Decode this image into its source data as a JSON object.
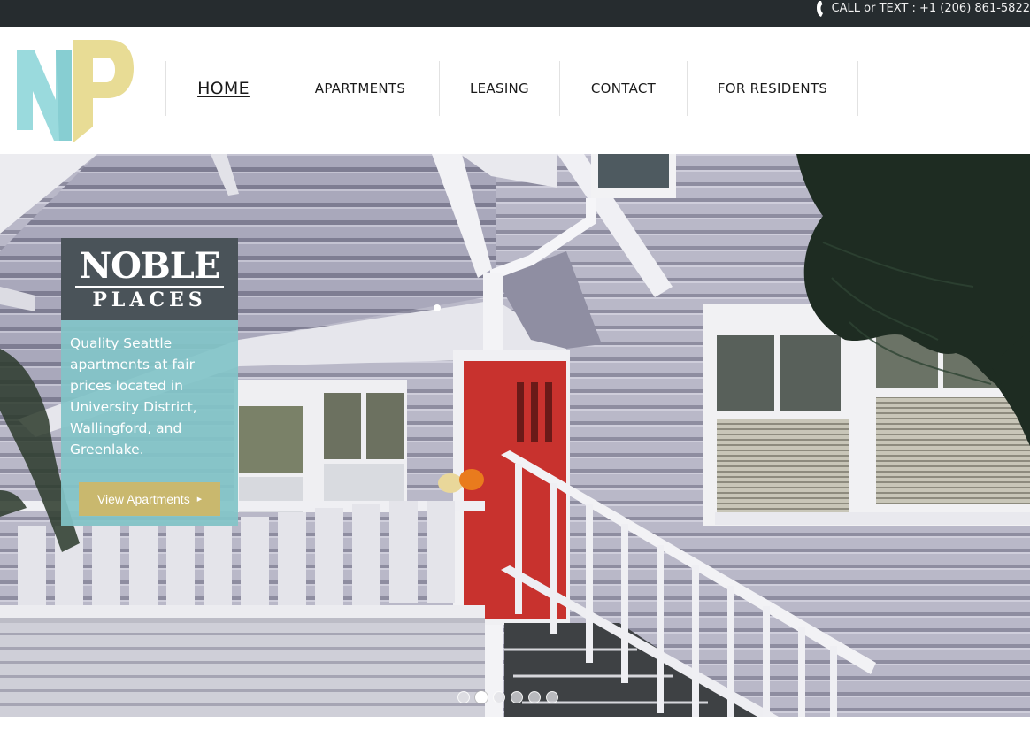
{
  "topbar": {
    "contact_text": "CALL or TEXT : +1 (206) 861-5822",
    "icon": "phone-icon"
  },
  "logo": {
    "letters": [
      "N",
      "P"
    ],
    "colors": {
      "n": "#9adadd",
      "p": "#e8dc95"
    }
  },
  "nav": {
    "items": [
      {
        "label": "HOME",
        "active": true
      },
      {
        "label": "APARTMENTS",
        "active": false
      },
      {
        "label": "LEASING",
        "active": false
      },
      {
        "label": "CONTACT",
        "active": false
      },
      {
        "label": "FOR RESIDENTS",
        "active": false
      }
    ]
  },
  "hero": {
    "brand": {
      "name_line1": "NOBLE",
      "name_line2": "PLACES",
      "tagline": "Quality Seattle apartments at fair prices located in University District, Wallingford, and Greenlake."
    },
    "cta": {
      "label": "View Apartments",
      "icon": "triangle-right-icon"
    },
    "slider": {
      "slide_count": 6,
      "active_index": 1
    }
  },
  "colors": {
    "topbar_bg": "#262c2f",
    "brand_head_bg": "#4a5359",
    "brand_body_bg": "#82c4c8",
    "cta_bg": "#c9b86e"
  }
}
